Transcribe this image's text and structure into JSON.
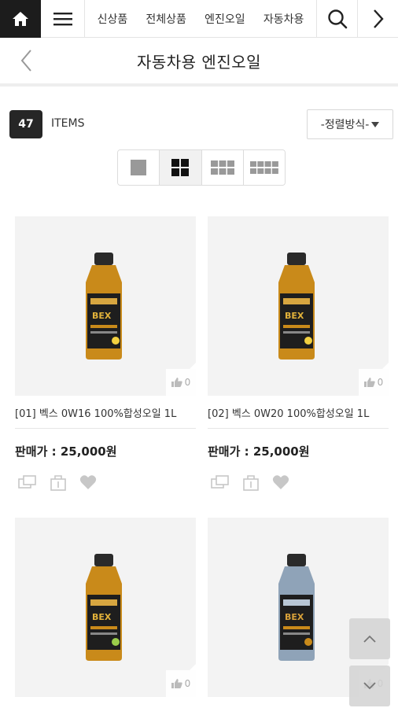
{
  "nav": {
    "items": [
      "신상품",
      "전체상품",
      "엔진오일",
      "자동차용"
    ]
  },
  "title": "자동차용 엔진오일",
  "list": {
    "count": "47",
    "items_label": "ITEMS",
    "sort_label": "-정렬방식-"
  },
  "products": [
    {
      "name": "[01] 벡스 0W16 100%합성오일 1L",
      "price": "판매가 : 25,000원",
      "likes": "0",
      "bottle": "gold"
    },
    {
      "name": "[02] 벡스 0W20 100%합성오일 1L",
      "price": "판매가 : 25,000원",
      "likes": "0",
      "bottle": "gold"
    },
    {
      "name": "",
      "price": "",
      "likes": "0",
      "bottle": "gold"
    },
    {
      "name": "",
      "price": "",
      "likes": "0",
      "bottle": "silver"
    }
  ],
  "floating": {
    "likes": "0"
  },
  "colors": {
    "home_bg": "#1c1c1c",
    "badge_bg": "#262626",
    "bottle_gold": "#c98a1a",
    "bottle_silver": "#8fa3b8"
  }
}
